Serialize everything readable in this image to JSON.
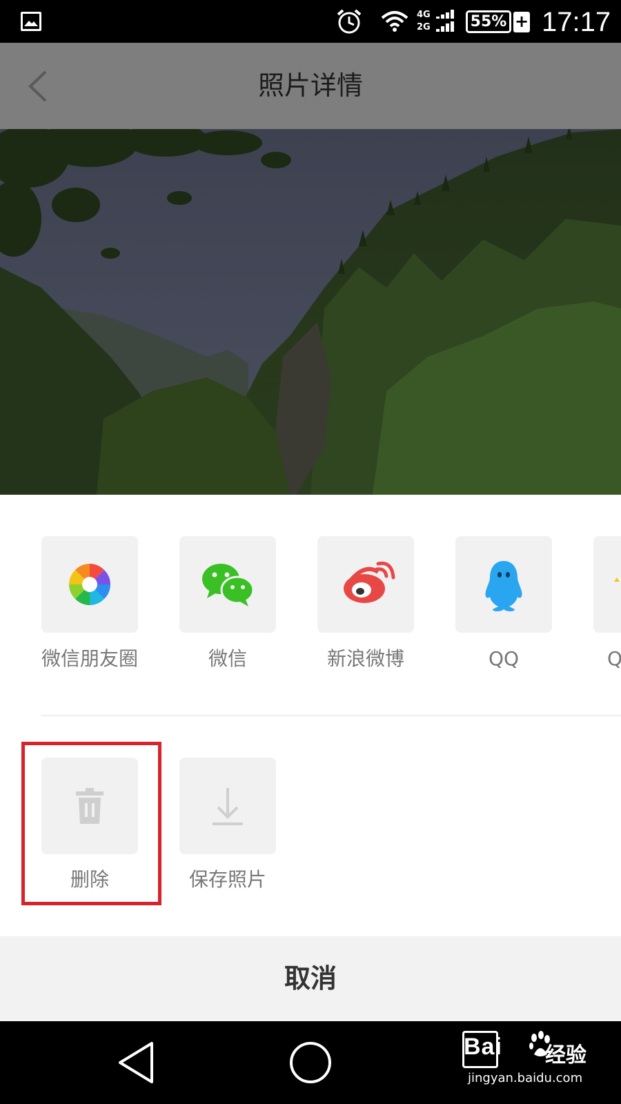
{
  "status_bar": {
    "network_4g": "4G",
    "network_2g": "2G",
    "battery": "55%",
    "charging": "+",
    "time": "17:17"
  },
  "header": {
    "title": "照片详情",
    "back_icon": "chevron-left-icon"
  },
  "share_targets": [
    {
      "label": "微信朋友圈",
      "icon": "moments-aperture-icon"
    },
    {
      "label": "微信",
      "icon": "wechat-icon"
    },
    {
      "label": "新浪微博",
      "icon": "weibo-icon"
    },
    {
      "label": "QQ",
      "icon": "qq-penguin-icon"
    },
    {
      "label": "Q",
      "icon": "qzone-star-icon"
    }
  ],
  "actions": [
    {
      "label": "删除",
      "icon": "trash-icon",
      "highlighted": true
    },
    {
      "label": "保存照片",
      "icon": "download-icon",
      "highlighted": false
    }
  ],
  "cancel_label": "取消",
  "watermark": {
    "brand": "Bai",
    "brand_cn": "经验",
    "url": "jingyan.baidu.com"
  },
  "colors": {
    "highlight_border": "#d8232a",
    "wechat_green": "#3ac025",
    "weibo_red": "#e84845",
    "qq_blue": "#2aa6f0"
  }
}
